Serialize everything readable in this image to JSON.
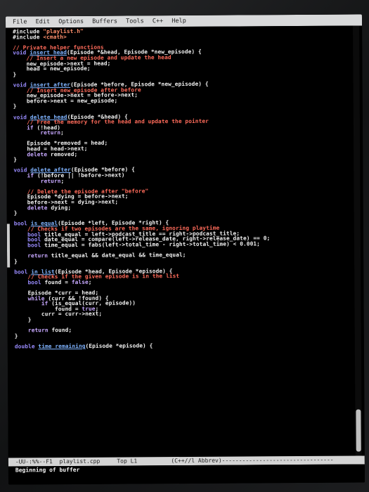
{
  "menu": [
    "File",
    "Edit",
    "Options",
    "Buffers",
    "Tools",
    "C++",
    "Help"
  ],
  "code_lines": [
    [
      {
        "c": "pp",
        "t": "#include \"playlist.h\""
      }
    ],
    [
      {
        "c": "pp",
        "t": "#include <cmath>"
      }
    ],
    [],
    [
      {
        "c": "cm",
        "t": "// Private helper functions"
      }
    ],
    [
      {
        "c": "kw",
        "t": "void "
      },
      {
        "c": "fn",
        "t": "insert_head"
      },
      {
        "c": "",
        "t": "(Episode *&head, Episode *new_episode) {"
      }
    ],
    [
      {
        "c": "",
        "t": "    "
      },
      {
        "c": "cm",
        "t": "// Insert a new episode and update the head"
      }
    ],
    [
      {
        "c": "",
        "t": "    new_episode->next = head;"
      }
    ],
    [
      {
        "c": "",
        "t": "    head = new_episode;"
      }
    ],
    [
      {
        "c": "",
        "t": "}"
      }
    ],
    [],
    [
      {
        "c": "kw",
        "t": "void "
      },
      {
        "c": "fn",
        "t": "insert_after"
      },
      {
        "c": "",
        "t": "(Episode *before, Episode *new_episode) {"
      }
    ],
    [
      {
        "c": "",
        "t": "    "
      },
      {
        "c": "cm",
        "t": "// Insert new_episode after before"
      }
    ],
    [
      {
        "c": "",
        "t": "    new_episode->next = before->next;"
      }
    ],
    [
      {
        "c": "",
        "t": "    before->next = new_episode;"
      }
    ],
    [
      {
        "c": "",
        "t": "}"
      }
    ],
    [],
    [
      {
        "c": "kw",
        "t": "void "
      },
      {
        "c": "fn",
        "t": "delete_head"
      },
      {
        "c": "",
        "t": "(Episode *&head) {"
      }
    ],
    [
      {
        "c": "",
        "t": "    "
      },
      {
        "c": "cm",
        "t": "// Free the memory for the head and update the pointer"
      }
    ],
    [
      {
        "c": "",
        "t": "    "
      },
      {
        "c": "ret",
        "t": "if"
      },
      {
        "c": "",
        "t": " (!head)"
      }
    ],
    [
      {
        "c": "",
        "t": "        "
      },
      {
        "c": "ret",
        "t": "return"
      },
      {
        "c": "",
        "t": ";"
      }
    ],
    [],
    [
      {
        "c": "",
        "t": "    Episode *removed = head;"
      }
    ],
    [
      {
        "c": "",
        "t": "    head = head->next;"
      }
    ],
    [
      {
        "c": "",
        "t": "    "
      },
      {
        "c": "ret",
        "t": "delete"
      },
      {
        "c": "",
        "t": " removed;"
      }
    ],
    [
      {
        "c": "",
        "t": "}"
      }
    ],
    [],
    [
      {
        "c": "kw",
        "t": "void "
      },
      {
        "c": "fn",
        "t": "delete_after"
      },
      {
        "c": "",
        "t": "(Episode *before) {"
      }
    ],
    [
      {
        "c": "",
        "t": "    "
      },
      {
        "c": "ret",
        "t": "if"
      },
      {
        "c": "",
        "t": " (!before || !before->next)"
      }
    ],
    [
      {
        "c": "",
        "t": "        "
      },
      {
        "c": "ret",
        "t": "return"
      },
      {
        "c": "",
        "t": ";"
      }
    ],
    [],
    [
      {
        "c": "",
        "t": "    "
      },
      {
        "c": "cm",
        "t": "// Delete the episode after \"before\""
      }
    ],
    [
      {
        "c": "",
        "t": "    Episode *dying = before->next;"
      }
    ],
    [
      {
        "c": "",
        "t": "    before->next = dying->next;"
      }
    ],
    [
      {
        "c": "",
        "t": "    "
      },
      {
        "c": "ret",
        "t": "delete"
      },
      {
        "c": "",
        "t": " dying;"
      }
    ],
    [
      {
        "c": "",
        "t": "}"
      }
    ],
    [],
    [
      {
        "c": "kw",
        "t": "bool "
      },
      {
        "c": "fn",
        "t": "is_equal"
      },
      {
        "c": "",
        "t": "(Episode *left, Episode *right) {"
      }
    ],
    [
      {
        "c": "",
        "t": "    "
      },
      {
        "c": "cm",
        "t": "// Checks if two episodes are the same, ignoring playtime"
      }
    ],
    [
      {
        "c": "",
        "t": "    "
      },
      {
        "c": "kw",
        "t": "bool"
      },
      {
        "c": "",
        "t": " title_equal = left->podcast_title == right->podcast_title;"
      }
    ],
    [
      {
        "c": "",
        "t": "    "
      },
      {
        "c": "kw",
        "t": "bool"
      },
      {
        "c": "",
        "t": " date_equal = compare(left->release_date, right->release_date) == 0;"
      }
    ],
    [
      {
        "c": "",
        "t": "    "
      },
      {
        "c": "kw",
        "t": "bool"
      },
      {
        "c": "",
        "t": " time_equal = fabs(left->total_time - right->total_time) < 0.001;"
      }
    ],
    [],
    [
      {
        "c": "",
        "t": "    "
      },
      {
        "c": "ret",
        "t": "return"
      },
      {
        "c": "",
        "t": " title_equal && date_equal && time_equal;"
      }
    ],
    [
      {
        "c": "",
        "t": "}"
      }
    ],
    [],
    [
      {
        "c": "kw",
        "t": "bool "
      },
      {
        "c": "fn",
        "t": "in_list"
      },
      {
        "c": "",
        "t": "(Episode *head, Episode *episode) {"
      }
    ],
    [
      {
        "c": "",
        "t": "    "
      },
      {
        "c": "cm",
        "t": "// Checks if the given episode is in the list"
      }
    ],
    [
      {
        "c": "",
        "t": "    "
      },
      {
        "c": "kw",
        "t": "bool"
      },
      {
        "c": "",
        "t": " found = "
      },
      {
        "c": "ret",
        "t": "false"
      },
      {
        "c": "",
        "t": ";"
      }
    ],
    [],
    [
      {
        "c": "",
        "t": "    Episode *curr = head;"
      }
    ],
    [
      {
        "c": "",
        "t": "    "
      },
      {
        "c": "ret",
        "t": "while"
      },
      {
        "c": "",
        "t": " (curr && !found) {"
      }
    ],
    [
      {
        "c": "",
        "t": "        "
      },
      {
        "c": "ret",
        "t": "if"
      },
      {
        "c": "",
        "t": " (is_equal(curr, episode))"
      }
    ],
    [
      {
        "c": "",
        "t": "            found = "
      },
      {
        "c": "ret",
        "t": "true"
      },
      {
        "c": "",
        "t": ";"
      }
    ],
    [
      {
        "c": "",
        "t": "        curr = curr->next;"
      }
    ],
    [
      {
        "c": "",
        "t": "    }"
      }
    ],
    [],
    [
      {
        "c": "",
        "t": "    "
      },
      {
        "c": "ret",
        "t": "return"
      },
      {
        "c": "",
        "t": " found;"
      }
    ],
    [
      {
        "c": "",
        "t": "}"
      }
    ],
    [],
    [
      {
        "c": "kw",
        "t": "double "
      },
      {
        "c": "fn",
        "t": "time_remaining"
      },
      {
        "c": "",
        "t": "(Episode *episode) {"
      }
    ]
  ],
  "modeline": "-UU-:%%--F1  playlist.cpp     Top L1          (C++//l Abbrev)---------------------------------",
  "echo_area": "Beginning of buffer",
  "colors": {
    "keyword": "#9a8cff",
    "function": "#7fb3ff",
    "comment": "#ff6b5a"
  }
}
